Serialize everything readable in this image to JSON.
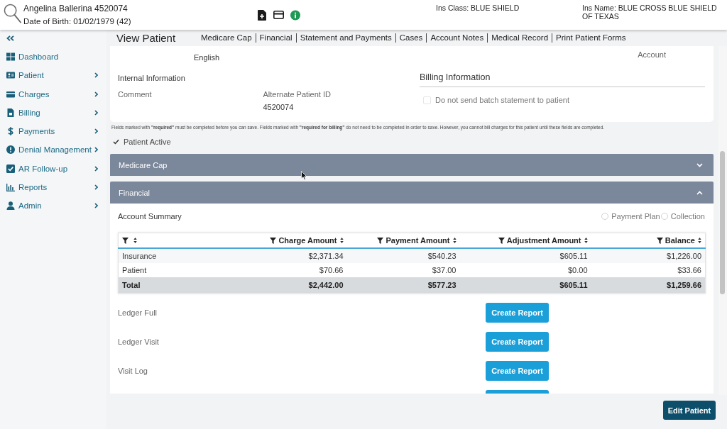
{
  "header": {
    "patient_name": "Angelina Ballerina 4520074",
    "date_of_birth": "Date of Birth: 01/02/1979 (42)",
    "ins_class": "Ins Class: BLUE SHIELD",
    "ins_name": "Ins Name: BLUE CROSS BLUE SHIELD OF TEXAS"
  },
  "sidebar": {
    "items": [
      {
        "label": "Dashboard",
        "has_submenu": false
      },
      {
        "label": "Patient",
        "has_submenu": true
      },
      {
        "label": "Charges",
        "has_submenu": true
      },
      {
        "label": "Billing",
        "has_submenu": true
      },
      {
        "label": "Payments",
        "has_submenu": true
      },
      {
        "label": "Denial Management",
        "has_submenu": true
      },
      {
        "label": "AR Follow-up",
        "has_submenu": true
      },
      {
        "label": "Reports",
        "has_submenu": true
      },
      {
        "label": "Admin",
        "has_submenu": true
      }
    ]
  },
  "page": {
    "title": "View Patient",
    "tabs": [
      {
        "label": "Medicare Cap",
        "selected": false
      },
      {
        "label": "Financial",
        "selected": false
      },
      {
        "label": "Statement and Payments",
        "selected": false
      },
      {
        "label": "Cases",
        "selected": false
      },
      {
        "label": "Account Notes",
        "selected": false
      },
      {
        "label": "Medical Record",
        "selected": false
      },
      {
        "label": "Print Patient Forms",
        "selected": false
      }
    ]
  },
  "scrolled_fields": [
    "English",
    "Account"
  ],
  "internal_information": {
    "title": "Internal Information",
    "fields": [
      {
        "label": "Comment"
      },
      {
        "label": "Alternate Patient ID",
        "value": "4520074"
      }
    ]
  },
  "billing_information": {
    "title": "Billing Information",
    "options": [
      {
        "label": "Do not send batch statement to patient",
        "checked": false,
        "disabled": true
      }
    ]
  },
  "required_note": "Fields marked with **\"required\"** must be completed before you can save. Fields marked with **\"required for billing\"** do not need to be completed in order to save. However, you cannot bill charges for this patient until these fields are completed.",
  "patient_active": {
    "label": "Patient Active",
    "checked": true
  },
  "sections": [
    {
      "title": "Medicare Cap",
      "expanded": false
    },
    {
      "title": "Financial",
      "expanded": true,
      "account_summary": "Account Summary",
      "options": [
        {
          "label": "Payment Plan",
          "selected": false
        },
        {
          "label": "Collection",
          "selected": false
        }
      ],
      "table": {
        "columns": [
          {
            "kind": "unlabeled"
          },
          {
            "kind": "labeled",
            "label": "Charge Amount"
          },
          {
            "kind": "labeled",
            "label": "Payment Amount"
          },
          {
            "kind": "labeled",
            "label": "Adjustment Amount"
          },
          {
            "kind": "labeled",
            "label": "Balance"
          }
        ],
        "rows": [
          {
            "kind": "body",
            "cells": [
              "Insurance",
              "$2,371.34",
              "$540.23",
              "$605.11",
              "$1,226.00"
            ]
          },
          {
            "kind": "body",
            "cells": [
              "Patient",
              "$70.66",
              "$37.00",
              "$0.00",
              "$33.66"
            ]
          },
          {
            "kind": "total",
            "cells": [
              "Total",
              "$2,442.00",
              "$577.23",
              "$605.11",
              "$1,259.66"
            ]
          }
        ]
      },
      "reports": [
        {
          "kind": "row",
          "label": "Ledger Full",
          "button": "Create Report"
        },
        {
          "kind": "row",
          "label": "Ledger Visit",
          "button": "Create Report"
        },
        {
          "kind": "row",
          "label": "Visit Log",
          "button": "Create Report"
        },
        {
          "kind": "cut"
        }
      ]
    }
  ],
  "footer": {
    "button": "Edit Patient"
  }
}
